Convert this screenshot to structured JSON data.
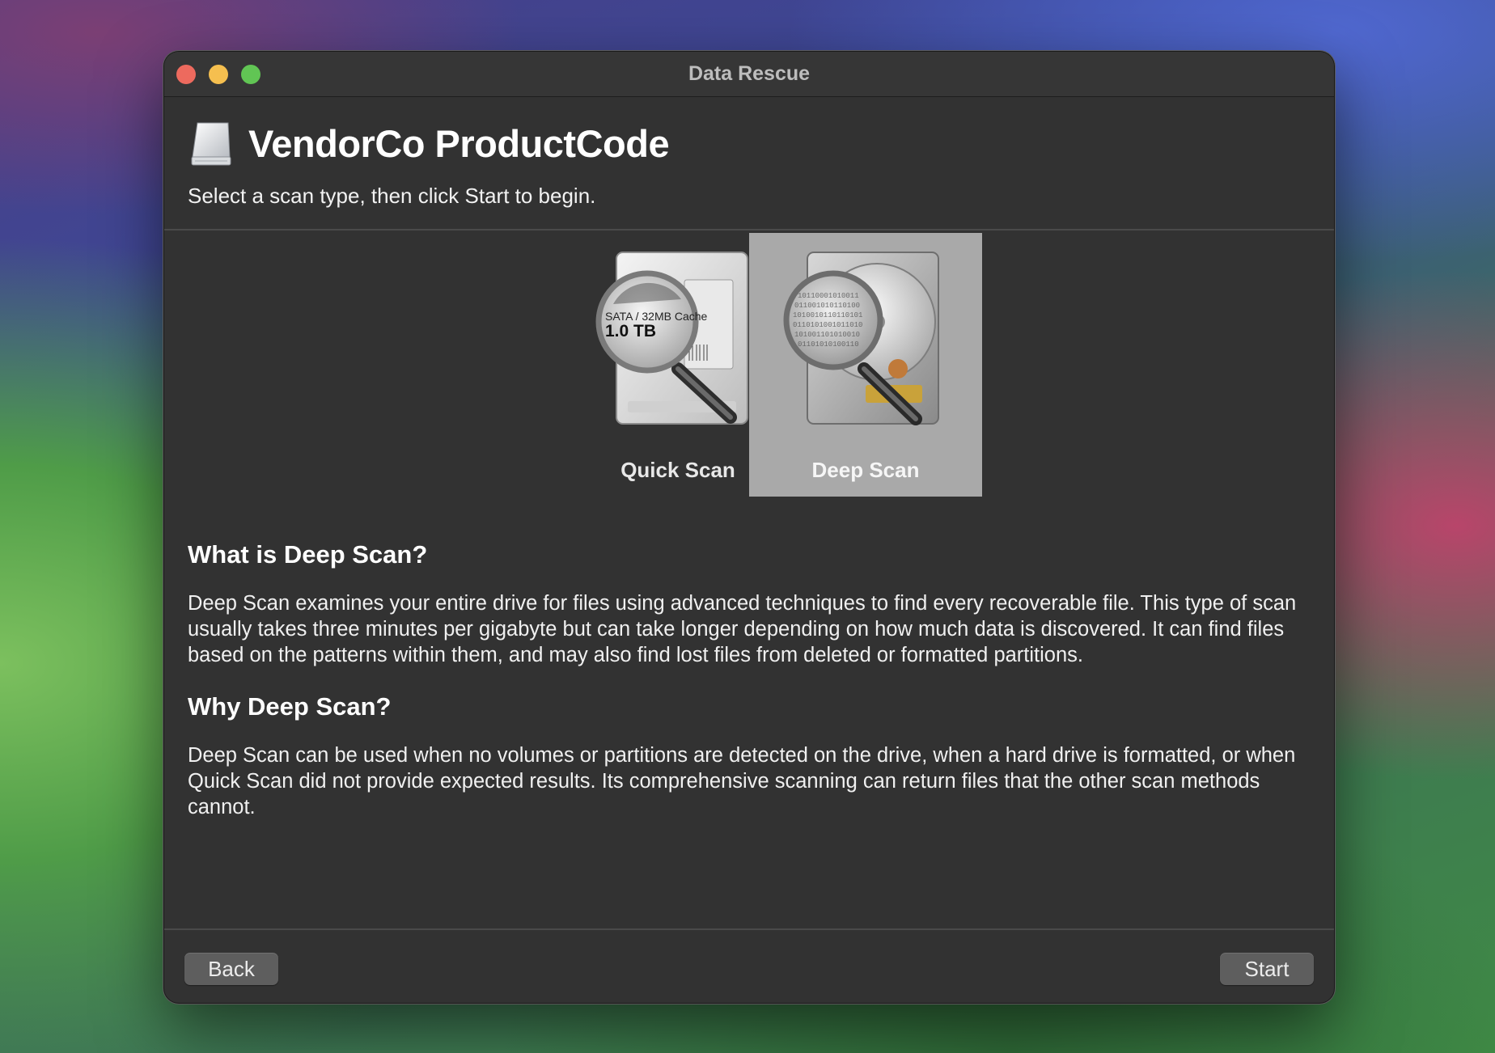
{
  "window": {
    "title": "Data Rescue"
  },
  "header": {
    "icon": "external-drive-icon",
    "device_name": "VendorCo ProductCode",
    "instruction": "Select a scan type, then click Start to begin."
  },
  "scan_types": [
    {
      "label": "Quick Scan",
      "icon": "quick-scan-drive-magnifier-icon",
      "selected": false,
      "drive_label_line1": "SATA / 32MB Cache",
      "drive_label_line2": "1.0 TB"
    },
    {
      "label": "Deep Scan",
      "icon": "deep-scan-drive-magnifier-icon",
      "selected": true
    }
  ],
  "info": {
    "what_title": "What is Deep Scan?",
    "what_body": "Deep Scan examines your entire drive for files using advanced techniques to find every recoverable file. This type of scan usually takes three minutes per gigabyte but can take longer depending on how much data is discovered. It can find files based on the patterns within them, and may also find lost files from deleted or formatted partitions.",
    "why_title": "Why Deep Scan?",
    "why_body": "Deep Scan can be used when no volumes or partitions are detected on the drive, when a hard drive is formatted, or when Quick Scan did not provide expected results. Its comprehensive scanning can return files that the other scan methods cannot."
  },
  "footer": {
    "back_label": "Back",
    "start_label": "Start"
  },
  "colors": {
    "window_bg": "#323232",
    "selected_bg": "#a9a9a9",
    "close": "#ed6a5e",
    "minimize": "#f5bf4f",
    "maximize": "#61c554"
  }
}
